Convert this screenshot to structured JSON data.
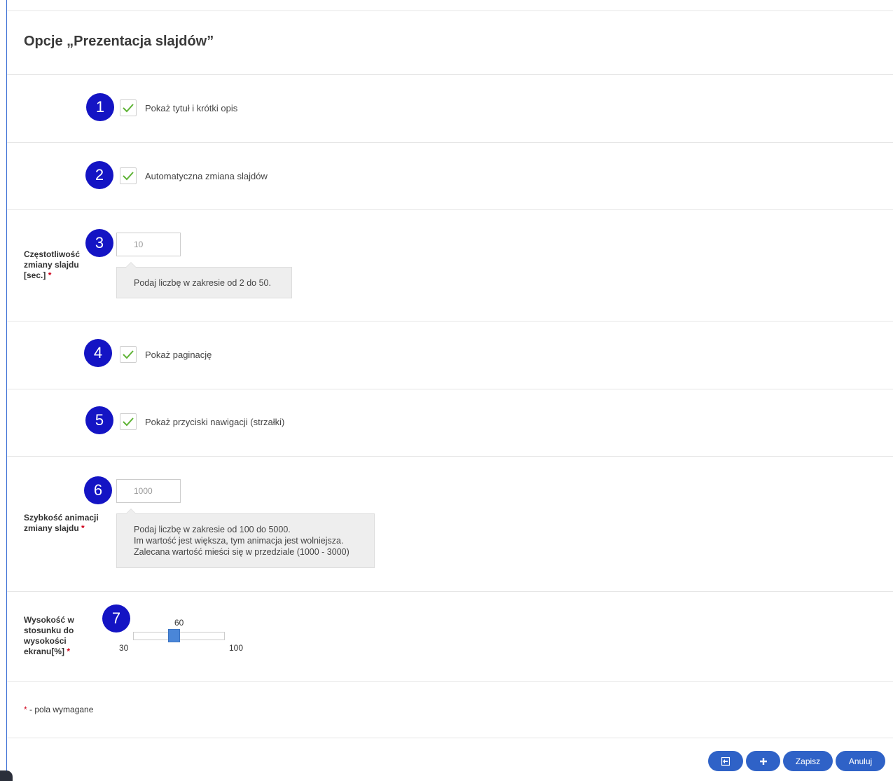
{
  "page": {
    "title": "Opcje „Prezentacja slajdów”",
    "accent_color": "#1414c4",
    "button_color": "#2f62c7",
    "check_color": "#5fb336"
  },
  "options": {
    "show_title": {
      "badge": "1",
      "label": "Pokaż tytuł i krótki opis",
      "checked": true
    },
    "auto_change": {
      "badge": "2",
      "label": "Automatyczna zmiana slajdów",
      "checked": true
    },
    "frequency": {
      "badge": "3",
      "label": "Częstotliwość zmiany slajdu [sec.]",
      "required_mark": "*",
      "value": "10",
      "hint_lines": [
        "Podaj liczbę w zakresie od 2 do 50."
      ]
    },
    "pagination": {
      "badge": "4",
      "label": "Pokaż paginację",
      "checked": true
    },
    "navigation": {
      "badge": "5",
      "label": "Pokaż przyciski nawigacji (strzałki)",
      "checked": true
    },
    "animation_speed": {
      "badge": "6",
      "label": "Szybkość animacji zmiany slajdu",
      "required_mark": "*",
      "value": "1000",
      "hint_lines": [
        "Podaj liczbę w zakresie od 100 do 5000.",
        "Im wartość jest większa, tym animacja jest wolniejsza.",
        "Zalecana wartość mieści się w przedziale (1000 - 3000)"
      ]
    },
    "height": {
      "badge": "7",
      "label": "Wysokość w stosunku do wysokości ekranu[%]",
      "required_mark": "*",
      "value": "60",
      "min": "30",
      "max": "100"
    }
  },
  "footnote": {
    "mark": "*",
    "text": " - pola wymagane"
  },
  "buttons": {
    "save_close_icon": "save-close-icon",
    "add_icon": "plus-icon",
    "save": "Zapisz",
    "cancel": "Anuluj"
  }
}
